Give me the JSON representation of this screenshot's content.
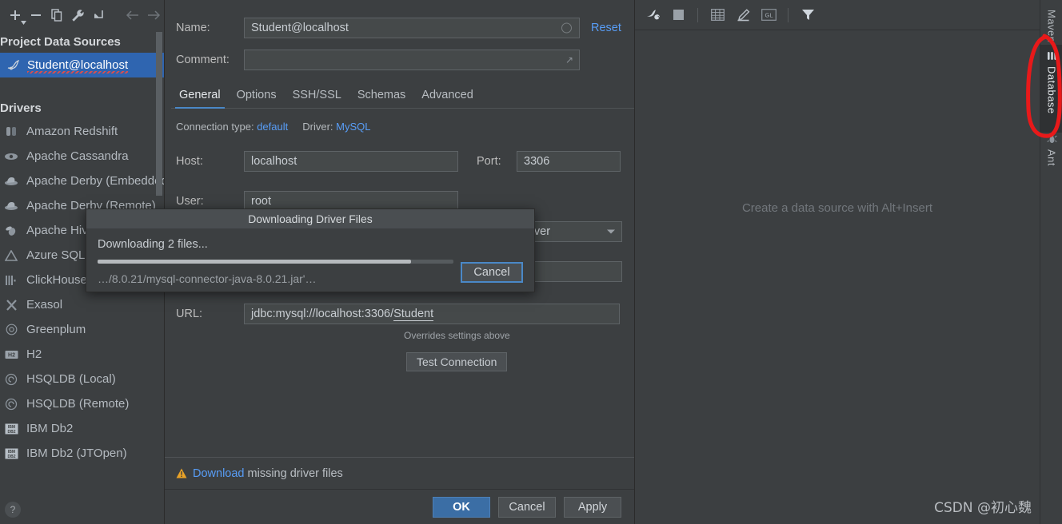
{
  "left_panel": {
    "toolbar": [
      {
        "name": "add-data-source-button",
        "icon": "plus-icon"
      },
      {
        "name": "remove-data-source-button",
        "icon": "minus-icon"
      },
      {
        "name": "duplicate-data-source-button",
        "icon": "copy-icon"
      },
      {
        "name": "data-source-properties-button",
        "icon": "wrench-icon"
      },
      {
        "name": "collapse-all-button",
        "icon": "collapse-arrow-icon"
      },
      {
        "name": "navigate-back-button",
        "icon": "arrow-left-icon"
      },
      {
        "name": "navigate-forward-button",
        "icon": "arrow-right-icon"
      }
    ],
    "project_section_title": "Project Data Sources",
    "data_sources": [
      {
        "label": "Student@localhost",
        "selected": true,
        "icon": "mysql-dolphin-icon"
      }
    ],
    "drivers_section_title": "Drivers",
    "drivers": [
      {
        "label": "Amazon Redshift",
        "icon": "redshift-icon"
      },
      {
        "label": "Apache Cassandra",
        "icon": "cassandra-eye-icon"
      },
      {
        "label": "Apache Derby (Embedded)",
        "icon": "derby-hat-icon"
      },
      {
        "label": "Apache Derby (Remote)",
        "icon": "derby-hat-icon"
      },
      {
        "label": "Apache Hive",
        "icon": "hive-bee-icon"
      },
      {
        "label": "Azure SQL Database",
        "icon": "azure-triangle-icon"
      },
      {
        "label": "ClickHouse",
        "icon": "clickhouse-bars-icon"
      },
      {
        "label": "Exasol",
        "icon": "exasol-x-icon"
      },
      {
        "label": "Greenplum",
        "icon": "greenplum-circle-icon"
      },
      {
        "label": "H2",
        "icon": "h2-icon"
      },
      {
        "label": "HSQLDB (Local)",
        "icon": "hsqldb-spiral-icon"
      },
      {
        "label": "HSQLDB (Remote)",
        "icon": "hsqldb-spiral-icon"
      },
      {
        "label": "IBM Db2",
        "icon": "ibm-db2-icon"
      },
      {
        "label": "IBM Db2 (JTOpen)",
        "icon": "ibm-db2-icon"
      }
    ],
    "help_button_label": "?"
  },
  "dialog": {
    "name_label": "Name:",
    "name_value": "Student@localhost",
    "name_placeholder": "",
    "reset_label": "Reset",
    "comment_label": "Comment:",
    "comment_value": "",
    "comment_placeholder": "",
    "tabs": [
      {
        "label": "General",
        "active": true
      },
      {
        "label": "Options",
        "active": false
      },
      {
        "label": "SSH/SSL",
        "active": false
      },
      {
        "label": "Schemas",
        "active": false
      },
      {
        "label": "Advanced",
        "active": false
      }
    ],
    "connection_type_label": "Connection type:",
    "connection_type_value": "default",
    "driver_label": "Driver:",
    "driver_value": "MySQL",
    "host_label": "Host:",
    "host_value": "localhost",
    "port_label": "Port:",
    "port_value": "3306",
    "user_label": "User:",
    "user_value": "root",
    "save_password_value": "rever",
    "database_value": "",
    "url_label": "URL:",
    "url_value": "jdbc:mysql://localhost:3306/",
    "url_value_underlined": "Student",
    "url_hint": "Overrides settings above",
    "test_connection_label": "Test Connection",
    "warning_link_text": "Download",
    "warning_rest_text": " missing driver files",
    "buttons": {
      "ok": "OK",
      "cancel": "Cancel",
      "apply": "Apply"
    }
  },
  "download_modal": {
    "title": "Downloading Driver Files",
    "status": "Downloading 2 files...",
    "file": "…/8.0.21/mysql-connector-java-8.0.21.jar'…",
    "progress_percent": 88,
    "cancel_label": "Cancel"
  },
  "main_area": {
    "toolbar": [
      {
        "name": "data-source-properties-icon",
        "icon": "db-wrench-icon"
      },
      {
        "name": "stop-icon",
        "icon": "stop-square-icon"
      },
      {
        "name": "table-view-icon",
        "icon": "grid-table-icon"
      },
      {
        "name": "edit-icon",
        "icon": "pencil-icon"
      },
      {
        "name": "gl-icon",
        "icon": "gl-box-icon"
      },
      {
        "name": "filter-icon",
        "icon": "funnel-icon"
      }
    ],
    "empty_message": "Create a data source with Alt+Insert",
    "watermark": "CSDN @初心魏"
  },
  "vertical_tabs": [
    {
      "label": "Maven",
      "active": false,
      "icon": "maven-icon"
    },
    {
      "label": "Database",
      "active": true,
      "icon": "database-icon"
    },
    {
      "label": "Ant",
      "active": false,
      "icon": "ant-icon"
    }
  ],
  "colors": {
    "background": "#3c3f41",
    "selection_blue": "#2f65b0",
    "link_blue": "#589df6",
    "accent_tab": "#4a88c7",
    "primary_button": "#3b6ea5",
    "warning_amber": "#e9a227",
    "annotation_red": "#e8191a"
  }
}
